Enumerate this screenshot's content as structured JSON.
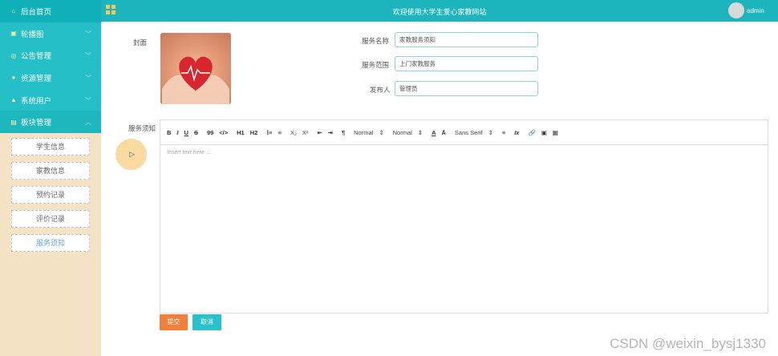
{
  "sidebar": {
    "items": [
      {
        "label": "后台首页",
        "icon": "home-icon",
        "glyph": "⌂"
      },
      {
        "label": "轮播图",
        "icon": "image-icon",
        "glyph": "▣"
      },
      {
        "label": "公告管理",
        "icon": "notice-icon",
        "glyph": "◎"
      },
      {
        "label": "资源管理",
        "icon": "resource-icon",
        "glyph": "●"
      },
      {
        "label": "系统用户",
        "icon": "user-icon",
        "glyph": "▲"
      },
      {
        "label": "板块管理",
        "icon": "module-icon",
        "glyph": "▤"
      }
    ],
    "subitems": [
      "学生信息",
      "家教信息",
      "预约记录",
      "评价记录",
      "服务须知"
    ],
    "active_sub": "服务须知"
  },
  "header": {
    "title": "欢迎使用大学生爱心家教网站",
    "username": "admin"
  },
  "form": {
    "cover_label": "封面",
    "service_name_label": "服务名称",
    "service_name_value": "家教服务须知",
    "service_scope_label": "服务范围",
    "service_scope_value": "上门家教服务",
    "publisher_label": "发布人",
    "publisher_value": "管理员",
    "notice_label": "服务须知",
    "editor_placeholder": "Insert text here ...",
    "submit_label": "提交",
    "cancel_label": "取消"
  },
  "toolbar": {
    "bold": "B",
    "italic": "I",
    "underline": "U",
    "strike": "S",
    "quote": "99",
    "code": "</>",
    "h1": "H1",
    "h2": "H2",
    "ol": "⁝≡",
    "ul": "≡",
    "sub": "X₂",
    "sup": "X²",
    "indent_l": "⇤",
    "indent_r": "⇥",
    "direction": "¶",
    "size_select": "Normal",
    "header_select": "Normal",
    "color": "A",
    "bg": "Ā",
    "font_select": "Sans Serif",
    "align": "≡",
    "clean": "Ix",
    "link": "🔗",
    "image": "▣",
    "video": "▦"
  },
  "watermark": "CSDN @weixin_bysj1330",
  "colors": {
    "header": "#1cb5bd",
    "sidebar": "#25c0c7",
    "submit": "#f0803c",
    "cancel": "#29c2c8"
  }
}
